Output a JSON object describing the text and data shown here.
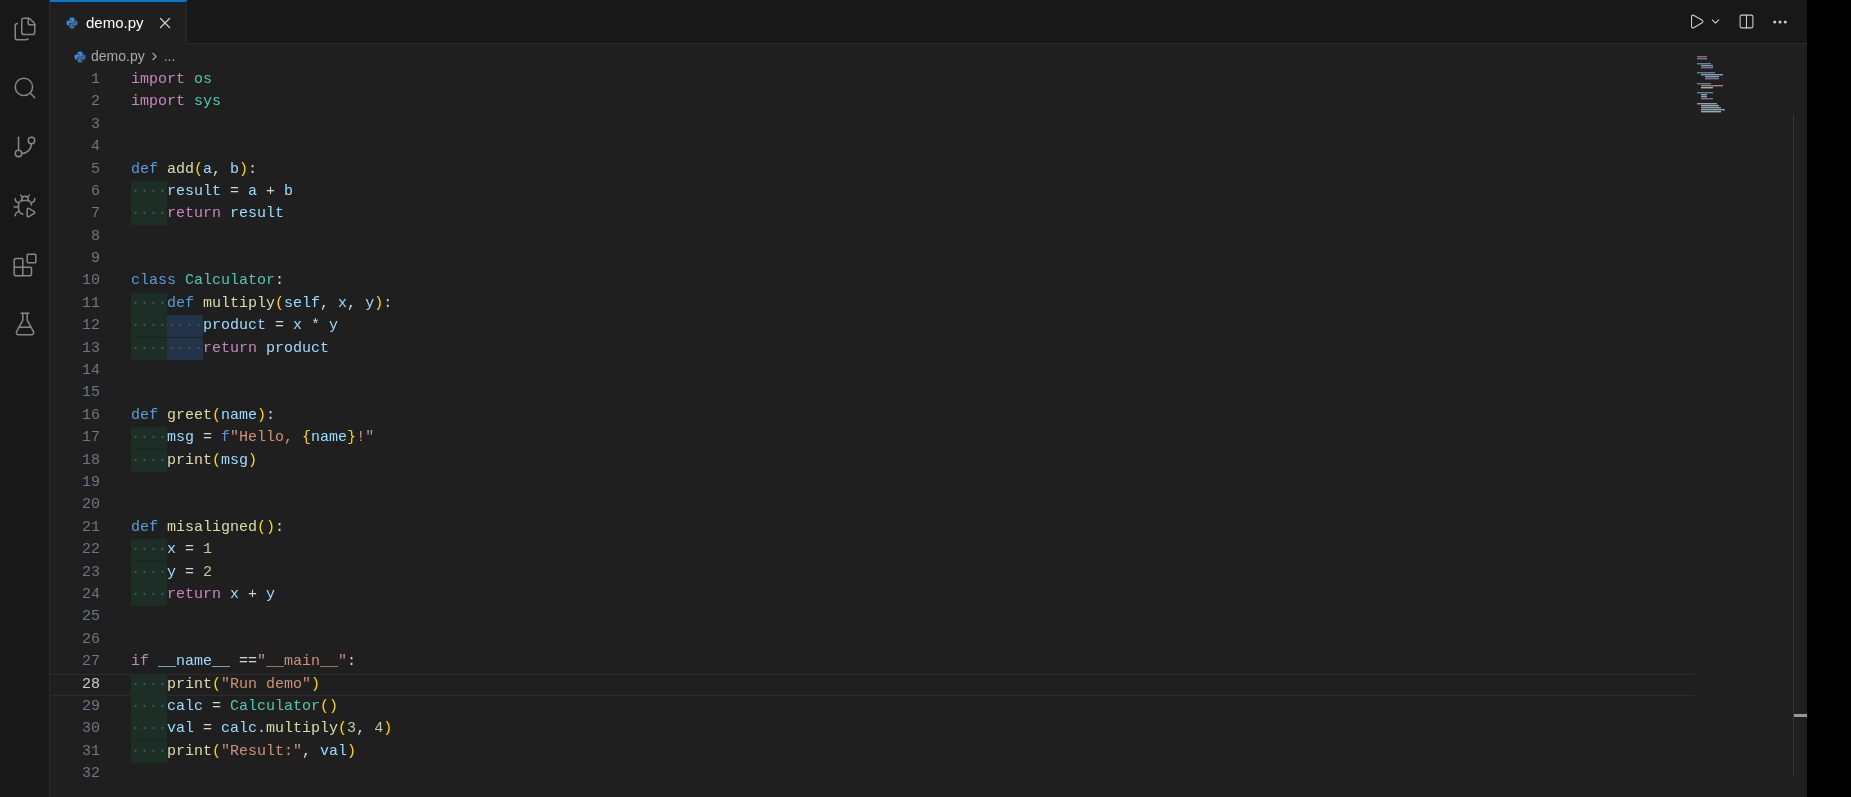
{
  "tabs": [
    {
      "label": "demo.py",
      "selected": true
    }
  ],
  "breadcrumb": [
    "demo.py",
    "..."
  ],
  "editor": {
    "lines": [
      {
        "number": "1",
        "current": false,
        "tokens": [
          {
            "t": "import",
            "kind": "kw"
          },
          {
            "t": " os",
            "kind": "type"
          }
        ]
      },
      {
        "number": "2",
        "current": false,
        "tokens": [
          {
            "t": "import",
            "kind": "kw"
          },
          {
            "t": " sys",
            "kind": "type"
          }
        ]
      },
      {
        "number": "3",
        "current": false
      },
      {
        "number": "4",
        "current": false
      },
      {
        "number": "5",
        "current": false,
        "tokens": [
          {
            "t": "def",
            "kind": "storage"
          },
          {
            "t": " add",
            "kind": "fn"
          },
          {
            "t": "(",
            "kind": "bracket"
          },
          {
            "t": "a",
            "kind": "var"
          },
          {
            "t": ", ",
            "kind": "op"
          },
          {
            "t": "b",
            "kind": "var"
          },
          {
            "t": ")",
            "kind": "bracket"
          },
          {
            "t": ":",
            "kind": "op"
          }
        ]
      },
      {
        "number": "6",
        "current": false,
        "tokens": [
          {
            "t": "····",
            "kind": "indent"
          },
          {
            "t": "result",
            "kind": "var"
          },
          {
            "t": " = ",
            "kind": "op"
          },
          {
            "t": "a",
            "kind": "var"
          },
          {
            "t": " + ",
            "kind": "op"
          },
          {
            "t": "b",
            "kind": "var"
          }
        ]
      },
      {
        "number": "7",
        "current": false,
        "tokens": [
          {
            "t": "····",
            "kind": "indent"
          },
          {
            "t": "return",
            "kind": "kw"
          },
          {
            "t": " result",
            "kind": "var"
          }
        ]
      },
      {
        "number": "8",
        "current": false
      },
      {
        "number": "9",
        "current": false
      },
      {
        "number": "10",
        "current": false,
        "tokens": [
          {
            "t": "class",
            "kind": "storage"
          },
          {
            "t": " Calculator",
            "kind": "type"
          },
          {
            "t": ":",
            "kind": "op"
          }
        ]
      },
      {
        "number": "11",
        "current": false,
        "tokens": [
          {
            "t": "····",
            "kind": "indent"
          },
          {
            "t": "def",
            "kind": "storage"
          },
          {
            "t": " multiply",
            "kind": "fn"
          },
          {
            "t": "(",
            "kind": "bracket"
          },
          {
            "t": "self",
            "kind": "var"
          },
          {
            "t": ", ",
            "kind": "op"
          },
          {
            "t": "x",
            "kind": "var"
          },
          {
            "t": ", ",
            "kind": "op"
          },
          {
            "t": "y",
            "kind": "var"
          },
          {
            "t": ")",
            "kind": "bracket"
          },
          {
            "t": ":",
            "kind": "op"
          }
        ]
      },
      {
        "number": "12",
        "current": false,
        "tokens": [
          {
            "t": "····",
            "kind": "indent"
          },
          {
            "t": "····",
            "kind": "indent"
          },
          {
            "t": "product",
            "kind": "var"
          },
          {
            "t": " = ",
            "kind": "op"
          },
          {
            "t": "x",
            "kind": "var"
          },
          {
            "t": " * ",
            "kind": "op"
          },
          {
            "t": "y",
            "kind": "var"
          }
        ]
      },
      {
        "number": "13",
        "current": false,
        "tokens": [
          {
            "t": "····",
            "kind": "indent"
          },
          {
            "t": "····",
            "kind": "indent"
          },
          {
            "t": "return",
            "kind": "kw"
          },
          {
            "t": " product",
            "kind": "var"
          }
        ]
      },
      {
        "number": "14",
        "current": false
      },
      {
        "number": "15",
        "current": false
      },
      {
        "number": "16",
        "current": false,
        "tokens": [
          {
            "t": "def",
            "kind": "storage"
          },
          {
            "t": " greet",
            "kind": "fn"
          },
          {
            "t": "(",
            "kind": "bracket"
          },
          {
            "t": "name",
            "kind": "var"
          },
          {
            "t": ")",
            "kind": "bracket"
          },
          {
            "t": ":",
            "kind": "op"
          }
        ]
      },
      {
        "number": "17",
        "current": false,
        "tokens": [
          {
            "t": "····",
            "kind": "indent"
          },
          {
            "t": "msg",
            "kind": "var"
          },
          {
            "t": " = ",
            "kind": "op"
          },
          {
            "t": "f",
            "kind": "storage"
          },
          {
            "t": "\"Hello, ",
            "kind": "str"
          },
          {
            "t": "{",
            "kind": "bracket"
          },
          {
            "t": "name",
            "kind": "var"
          },
          {
            "t": "}",
            "kind": "bracket"
          },
          {
            "t": "!\"",
            "kind": "str"
          }
        ]
      },
      {
        "number": "18",
        "current": false,
        "tokens": [
          {
            "t": "····",
            "kind": "indent"
          },
          {
            "t": "print",
            "kind": "fn"
          },
          {
            "t": "(",
            "kind": "bracket"
          },
          {
            "t": "msg",
            "kind": "var"
          },
          {
            "t": ")",
            "kind": "bracket"
          }
        ]
      },
      {
        "number": "19",
        "current": false
      },
      {
        "number": "20",
        "current": false
      },
      {
        "number": "21",
        "current": false,
        "tokens": [
          {
            "t": "def",
            "kind": "storage"
          },
          {
            "t": " misaligned",
            "kind": "fn"
          },
          {
            "t": "()",
            "kind": "bracket"
          },
          {
            "t": ":",
            "kind": "op"
          }
        ]
      },
      {
        "number": "22",
        "current": false,
        "tokens": [
          {
            "t": "····",
            "kind": "indent"
          },
          {
            "t": "x",
            "kind": "var"
          },
          {
            "t": " = ",
            "kind": "op"
          },
          {
            "t": "1",
            "kind": "num"
          }
        ]
      },
      {
        "number": "23",
        "current": false,
        "tokens": [
          {
            "t": "····",
            "kind": "indent"
          },
          {
            "t": "y",
            "kind": "var"
          },
          {
            "t": " = ",
            "kind": "op"
          },
          {
            "t": "2",
            "kind": "num"
          }
        ]
      },
      {
        "number": "24",
        "current": false,
        "tokens": [
          {
            "t": "····",
            "kind": "indent"
          },
          {
            "t": "return",
            "kind": "kw"
          },
          {
            "t": " x",
            "kind": "var"
          },
          {
            "t": " + ",
            "kind": "op"
          },
          {
            "t": "y",
            "kind": "var"
          }
        ]
      },
      {
        "number": "25",
        "current": false
      },
      {
        "number": "26",
        "current": false
      },
      {
        "number": "27",
        "current": false,
        "tokens": [
          {
            "t": "if",
            "kind": "kw"
          },
          {
            "t": " __name__",
            "kind": "var"
          },
          {
            "t": " ==",
            "kind": "op"
          },
          {
            "t": "\"__main__\"",
            "kind": "str"
          },
          {
            "t": ":",
            "kind": "op"
          }
        ]
      },
      {
        "number": "28",
        "current": true,
        "tokens": [
          {
            "t": "····",
            "kind": "indent"
          },
          {
            "t": "print",
            "kind": "fn"
          },
          {
            "t": "(",
            "kind": "bracket"
          },
          {
            "t": "\"Run demo\"",
            "kind": "str"
          },
          {
            "t": ")",
            "kind": "bracket"
          }
        ]
      },
      {
        "number": "29",
        "current": false,
        "tokens": [
          {
            "t": "····",
            "kind": "indent"
          },
          {
            "t": "calc",
            "kind": "var"
          },
          {
            "t": " = ",
            "kind": "op"
          },
          {
            "t": "Calculator",
            "kind": "type"
          },
          {
            "t": "()",
            "kind": "bracket"
          }
        ]
      },
      {
        "number": "30",
        "current": false,
        "tokens": [
          {
            "t": "····",
            "kind": "indent"
          },
          {
            "t": "val",
            "kind": "var"
          },
          {
            "t": " = ",
            "kind": "op"
          },
          {
            "t": "calc",
            "kind": "var"
          },
          {
            "t": ".",
            "kind": "op"
          },
          {
            "t": "multiply",
            "kind": "fn"
          },
          {
            "t": "(",
            "kind": "bracket"
          },
          {
            "t": "3",
            "kind": "num"
          },
          {
            "t": ", ",
            "kind": "op"
          },
          {
            "t": "4",
            "kind": "num"
          },
          {
            "t": ")",
            "kind": "bracket"
          }
        ]
      },
      {
        "number": "31",
        "current": false,
        "tokens": [
          {
            "t": "····",
            "kind": "indent"
          },
          {
            "t": "print",
            "kind": "fn"
          },
          {
            "t": "(",
            "kind": "bracket"
          },
          {
            "t": "\"Result:\"",
            "kind": "str"
          },
          {
            "t": ", ",
            "kind": "op"
          },
          {
            "t": "val",
            "kind": "var"
          },
          {
            "t": ")",
            "kind": "bracket"
          }
        ]
      },
      {
        "number": "32",
        "current": false
      }
    ]
  }
}
